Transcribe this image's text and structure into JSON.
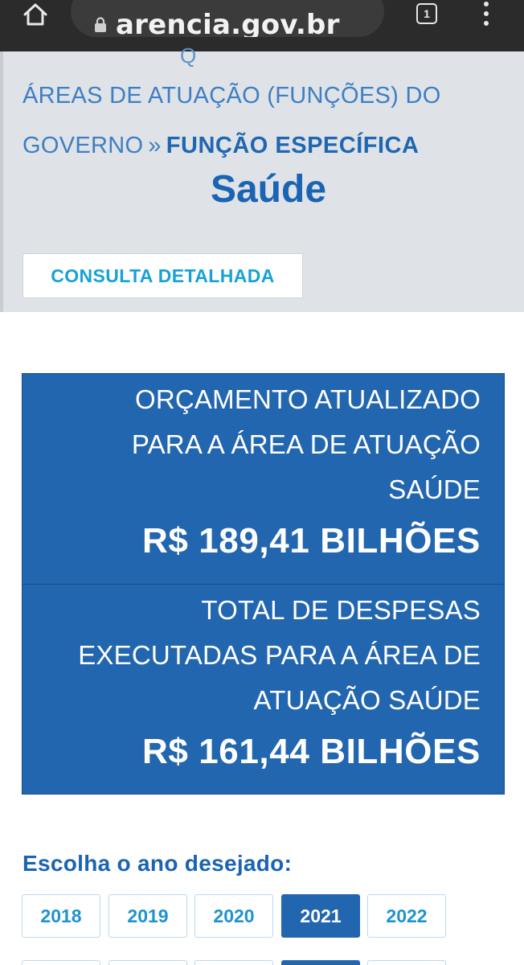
{
  "browser": {
    "url": "arencia.gov.br",
    "tab_count": "1",
    "icons": [
      "home-icon",
      "lock-icon",
      "tab-switcher-icon",
      "overflow-menu-icon"
    ]
  },
  "header": {
    "peek_char": "Q",
    "breadcrumb": {
      "parent_line1": "ÁREAS DE ATUAÇÃO (FUNÇÕES) DO",
      "parent_line2": "GOVERNO",
      "separator": "»",
      "current": "FUNÇÃO ESPECÍFICA"
    },
    "title": "Saúde",
    "detail_button": "CONSULTA DETALHADA"
  },
  "panels": {
    "budget": {
      "label_lines": [
        "ORÇAMENTO ATUALIZADO",
        "PARA A ÁREA DE ATUAÇÃO",
        "SAÚDE"
      ],
      "value": "R$ 189,41 BILHÕES"
    },
    "expenses": {
      "label_lines": [
        "TOTAL DE DESPESAS",
        "EXECUTADAS PARA A ÁREA DE",
        "ATUAÇÃO SAÚDE"
      ],
      "value": "R$ 161,44 BILHÕES"
    }
  },
  "years": {
    "prompt": "Escolha o ano desejado:",
    "options": [
      "2018",
      "2019",
      "2020",
      "2021",
      "2022"
    ],
    "selected": "2021"
  },
  "colors": {
    "browser_bar": "#2b2b2b",
    "header_bg": "#dfe2e6",
    "link_blue": "#3d7fc4",
    "title_blue": "#1a64b4",
    "panel_blue": "#2266b0",
    "button_text": "#17a1d8"
  }
}
